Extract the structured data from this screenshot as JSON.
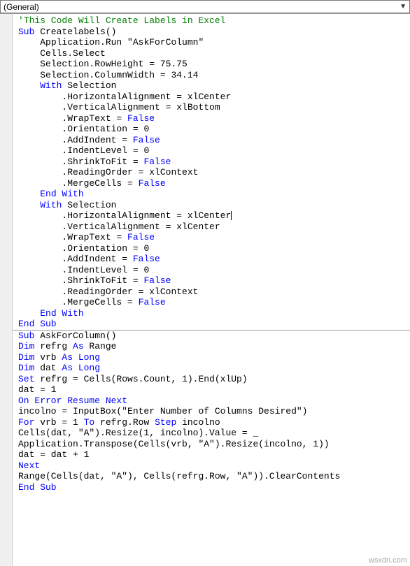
{
  "dropdown": {
    "label": "(General)"
  },
  "code": {
    "lines": [
      {
        "indent": 0,
        "tokens": [
          {
            "t": "c-comment",
            "v": "'This Code Will Create Labels in Excel"
          }
        ]
      },
      {
        "indent": 0,
        "tokens": [
          {
            "t": "c-keyword",
            "v": "Sub"
          },
          {
            "t": "c-default",
            "v": " Createlabels()"
          }
        ]
      },
      {
        "indent": 1,
        "tokens": [
          {
            "t": "c-default",
            "v": "Application.Run \"AskForColumn\""
          }
        ]
      },
      {
        "indent": 1,
        "tokens": [
          {
            "t": "c-default",
            "v": "Cells.Select"
          }
        ]
      },
      {
        "indent": 1,
        "tokens": [
          {
            "t": "c-default",
            "v": "Selection.RowHeight = 75.75"
          }
        ]
      },
      {
        "indent": 1,
        "tokens": [
          {
            "t": "c-default",
            "v": "Selection.ColumnWidth = 34.14"
          }
        ]
      },
      {
        "indent": 1,
        "tokens": [
          {
            "t": "c-keyword",
            "v": "With"
          },
          {
            "t": "c-default",
            "v": " Selection"
          }
        ]
      },
      {
        "indent": 2,
        "tokens": [
          {
            "t": "c-default",
            "v": ".HorizontalAlignment = xlCenter"
          }
        ]
      },
      {
        "indent": 2,
        "tokens": [
          {
            "t": "c-default",
            "v": ".VerticalAlignment = xlBottom"
          }
        ]
      },
      {
        "indent": 2,
        "tokens": [
          {
            "t": "c-default",
            "v": ".WrapText = "
          },
          {
            "t": "c-keyword",
            "v": "False"
          }
        ]
      },
      {
        "indent": 2,
        "tokens": [
          {
            "t": "c-default",
            "v": ".Orientation = 0"
          }
        ]
      },
      {
        "indent": 2,
        "tokens": [
          {
            "t": "c-default",
            "v": ".AddIndent = "
          },
          {
            "t": "c-keyword",
            "v": "False"
          }
        ]
      },
      {
        "indent": 2,
        "tokens": [
          {
            "t": "c-default",
            "v": ".IndentLevel = 0"
          }
        ]
      },
      {
        "indent": 2,
        "tokens": [
          {
            "t": "c-default",
            "v": ".ShrinkToFit = "
          },
          {
            "t": "c-keyword",
            "v": "False"
          }
        ]
      },
      {
        "indent": 2,
        "tokens": [
          {
            "t": "c-default",
            "v": ".ReadingOrder = xlContext"
          }
        ]
      },
      {
        "indent": 2,
        "tokens": [
          {
            "t": "c-default",
            "v": ".MergeCells = "
          },
          {
            "t": "c-keyword",
            "v": "False"
          }
        ]
      },
      {
        "indent": 1,
        "tokens": [
          {
            "t": "c-keyword",
            "v": "End With"
          }
        ]
      },
      {
        "indent": 1,
        "tokens": [
          {
            "t": "c-keyword",
            "v": "With"
          },
          {
            "t": "c-default",
            "v": " Selection"
          }
        ]
      },
      {
        "indent": 2,
        "cursor": true,
        "tokens": [
          {
            "t": "c-default",
            "v": ".HorizontalAlignment = xlCenter"
          }
        ]
      },
      {
        "indent": 2,
        "tokens": [
          {
            "t": "c-default",
            "v": ".VerticalAlignment = xlCenter"
          }
        ]
      },
      {
        "indent": 2,
        "tokens": [
          {
            "t": "c-default",
            "v": ".WrapText = "
          },
          {
            "t": "c-keyword",
            "v": "False"
          }
        ]
      },
      {
        "indent": 2,
        "tokens": [
          {
            "t": "c-default",
            "v": ".Orientation = 0"
          }
        ]
      },
      {
        "indent": 2,
        "tokens": [
          {
            "t": "c-default",
            "v": ".AddIndent = "
          },
          {
            "t": "c-keyword",
            "v": "False"
          }
        ]
      },
      {
        "indent": 2,
        "tokens": [
          {
            "t": "c-default",
            "v": ".IndentLevel = 0"
          }
        ]
      },
      {
        "indent": 2,
        "tokens": [
          {
            "t": "c-default",
            "v": ".ShrinkToFit = "
          },
          {
            "t": "c-keyword",
            "v": "False"
          }
        ]
      },
      {
        "indent": 2,
        "tokens": [
          {
            "t": "c-default",
            "v": ".ReadingOrder = xlContext"
          }
        ]
      },
      {
        "indent": 2,
        "tokens": [
          {
            "t": "c-default",
            "v": ".MergeCells = "
          },
          {
            "t": "c-keyword",
            "v": "False"
          }
        ]
      },
      {
        "indent": 1,
        "tokens": [
          {
            "t": "c-keyword",
            "v": "End With"
          }
        ]
      },
      {
        "indent": 0,
        "tokens": [
          {
            "t": "c-keyword",
            "v": "End Sub"
          }
        ]
      },
      {
        "divider": true
      },
      {
        "indent": 0,
        "tokens": [
          {
            "t": "c-keyword",
            "v": "Sub"
          },
          {
            "t": "c-default",
            "v": " AskForColumn()"
          }
        ]
      },
      {
        "indent": 0,
        "tokens": [
          {
            "t": "c-keyword",
            "v": "Dim"
          },
          {
            "t": "c-default",
            "v": " refrg "
          },
          {
            "t": "c-keyword",
            "v": "As"
          },
          {
            "t": "c-default",
            "v": " Range"
          }
        ]
      },
      {
        "indent": 0,
        "tokens": [
          {
            "t": "c-keyword",
            "v": "Dim"
          },
          {
            "t": "c-default",
            "v": " vrb "
          },
          {
            "t": "c-keyword",
            "v": "As Long"
          }
        ]
      },
      {
        "indent": 0,
        "tokens": [
          {
            "t": "c-keyword",
            "v": "Dim"
          },
          {
            "t": "c-default",
            "v": " dat "
          },
          {
            "t": "c-keyword",
            "v": "As Long"
          }
        ]
      },
      {
        "indent": 0,
        "tokens": [
          {
            "t": "c-keyword",
            "v": "Set"
          },
          {
            "t": "c-default",
            "v": " refrg = Cells(Rows.Count, 1).End(xlUp)"
          }
        ]
      },
      {
        "indent": 0,
        "tokens": [
          {
            "t": "c-default",
            "v": "dat = 1"
          }
        ]
      },
      {
        "indent": 0,
        "tokens": [
          {
            "t": "c-keyword",
            "v": "On Error Resume Next"
          }
        ]
      },
      {
        "indent": 0,
        "tokens": [
          {
            "t": "c-default",
            "v": "incolno = InputBox(\"Enter Number of Columns Desired\")"
          }
        ]
      },
      {
        "indent": 0,
        "tokens": [
          {
            "t": "c-keyword",
            "v": "For"
          },
          {
            "t": "c-default",
            "v": " vrb = 1 "
          },
          {
            "t": "c-keyword",
            "v": "To"
          },
          {
            "t": "c-default",
            "v": " refrg.Row "
          },
          {
            "t": "c-keyword",
            "v": "Step"
          },
          {
            "t": "c-default",
            "v": " incolno"
          }
        ]
      },
      {
        "indent": 0,
        "tokens": [
          {
            "t": "c-default",
            "v": "Cells(dat, \"A\").Resize(1, incolno).Value = _"
          }
        ]
      },
      {
        "indent": 0,
        "tokens": [
          {
            "t": "c-default",
            "v": "Application.Transpose(Cells(vrb, \"A\").Resize(incolno, 1))"
          }
        ]
      },
      {
        "indent": 0,
        "tokens": [
          {
            "t": "c-default",
            "v": "dat = dat + 1"
          }
        ]
      },
      {
        "indent": 0,
        "tokens": [
          {
            "t": "c-keyword",
            "v": "Next"
          }
        ]
      },
      {
        "indent": 0,
        "tokens": [
          {
            "t": "c-default",
            "v": "Range(Cells(dat, \"A\"), Cells(refrg.Row, \"A\")).ClearContents"
          }
        ]
      },
      {
        "indent": 0,
        "tokens": [
          {
            "t": "c-keyword",
            "v": "End Sub"
          }
        ]
      }
    ]
  },
  "watermark": "wsxdn.com"
}
